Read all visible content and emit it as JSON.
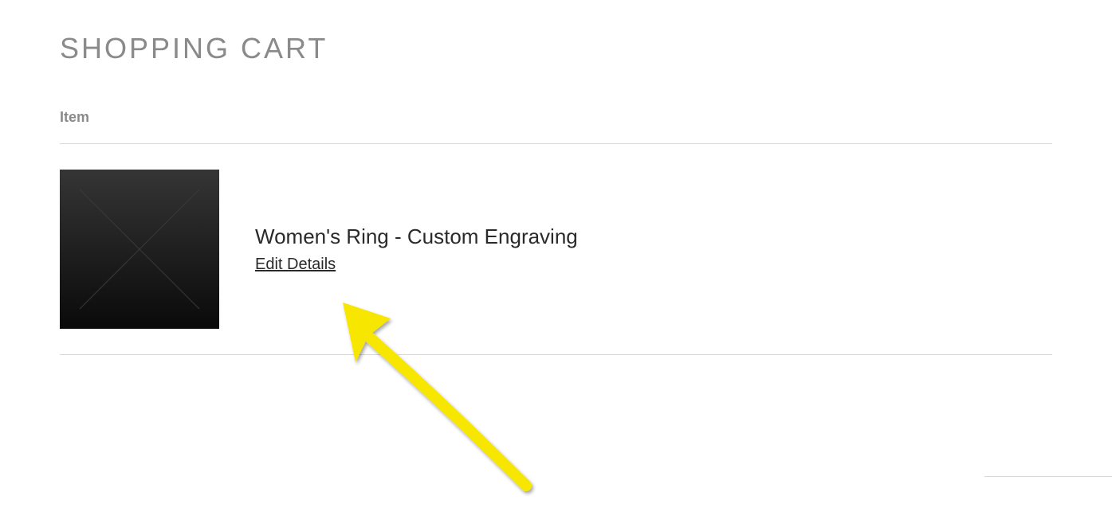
{
  "page": {
    "title": "SHOPPING CART"
  },
  "columns": {
    "item_label": "Item"
  },
  "cart": {
    "items": [
      {
        "name": "Women's Ring - Custom Engraving",
        "edit_label": "Edit Details"
      }
    ]
  }
}
